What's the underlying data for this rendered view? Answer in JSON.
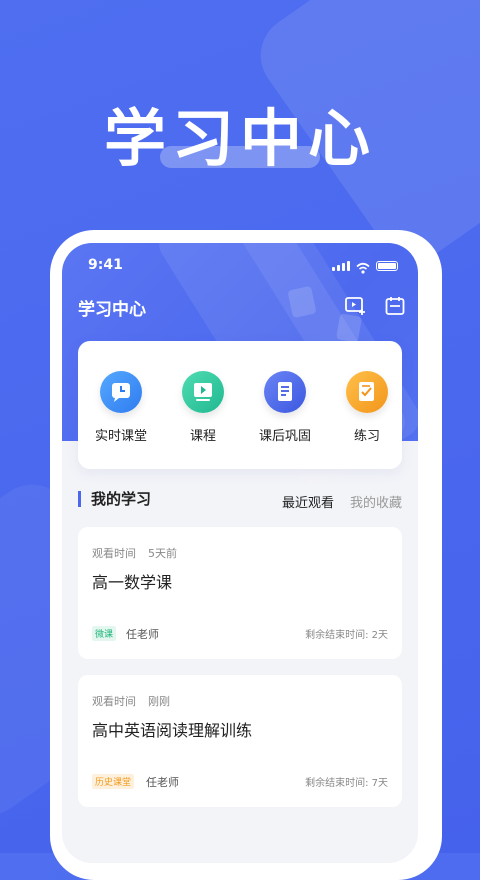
{
  "hero": {
    "title": "学习中心"
  },
  "status_bar": {
    "time": "9:41"
  },
  "header": {
    "title": "学习中心",
    "icons": [
      "video-add-icon",
      "calendar-icon"
    ]
  },
  "quick_actions": [
    {
      "label": "实时课堂",
      "icon": "clock-chat-icon",
      "color": "#3a8ef6"
    },
    {
      "label": "课程",
      "icon": "video-play-icon",
      "color": "#2fc9a0"
    },
    {
      "label": "课后巩固",
      "icon": "document-list-icon",
      "color": "#4a64e8"
    },
    {
      "label": "练习",
      "icon": "checklist-icon",
      "color": "#f6a21e"
    }
  ],
  "my_learning": {
    "title": "我的学习",
    "tabs": [
      {
        "label": "最近观看",
        "active": true
      },
      {
        "label": "我的收藏",
        "active": false
      }
    ]
  },
  "courses": [
    {
      "watch_label": "观看时间",
      "watch_time": "5天前",
      "title": "高一数学课",
      "badge": "微课",
      "badge_color": "#22b57a",
      "teacher": "任老师",
      "remaining": "剩余结束时间: 2天"
    },
    {
      "watch_label": "观看时间",
      "watch_time": "刚刚",
      "title": "高中英语阅读理解训练",
      "badge": "历史课堂",
      "badge_color": "#f39a1c",
      "teacher": "任老师",
      "remaining": "剩余结束时间: 7天"
    }
  ]
}
